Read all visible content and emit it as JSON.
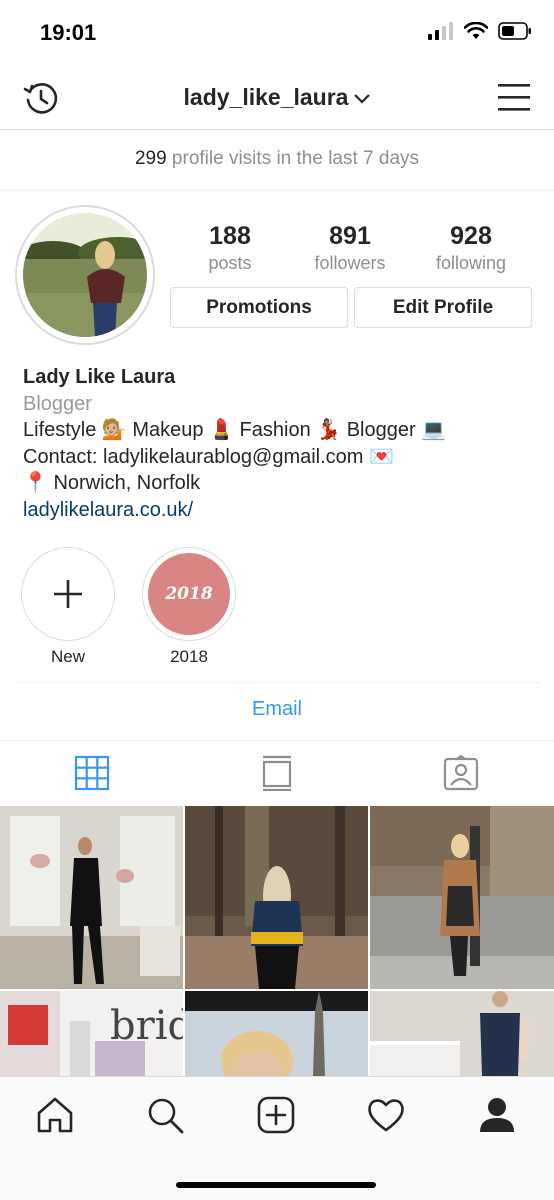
{
  "status_bar": {
    "time": "19:01"
  },
  "header": {
    "username": "lady_like_laura"
  },
  "visits": {
    "count": "299",
    "text": "profile visits in the last 7 days"
  },
  "stats": [
    {
      "value": "188",
      "label": "posts"
    },
    {
      "value": "891",
      "label": "followers"
    },
    {
      "value": "928",
      "label": "following"
    }
  ],
  "buttons": {
    "promotions": "Promotions",
    "edit_profile": "Edit Profile"
  },
  "bio": {
    "name": "Lady Like Laura",
    "category": "Blogger",
    "line1": "Lifestyle 💁🏼 Makeup 💄 Fashion 💃🏽 Blogger 💻",
    "line2": "Contact: ladylikelaurablog@gmail.com 💌",
    "line3": "📍 Norwich, Norfolk",
    "link": "ladylikelaura.co.uk/"
  },
  "highlights": [
    {
      "label": "New"
    },
    {
      "label": "2018",
      "cover_text": "2018",
      "cover_color": "#d98583"
    }
  ],
  "contact": {
    "email_label": "Email"
  },
  "colors": {
    "accent": "#3897f0",
    "link": "#0a3b6c",
    "muted": "#8e8e8e",
    "border": "#dbdbdb"
  },
  "icons": [
    "history-icon",
    "chevron-down-icon",
    "menu-icon",
    "plus-icon",
    "grid-icon",
    "feed-icon",
    "tagged-icon",
    "home-icon",
    "search-icon",
    "add-post-icon",
    "heart-icon",
    "profile-icon"
  ]
}
